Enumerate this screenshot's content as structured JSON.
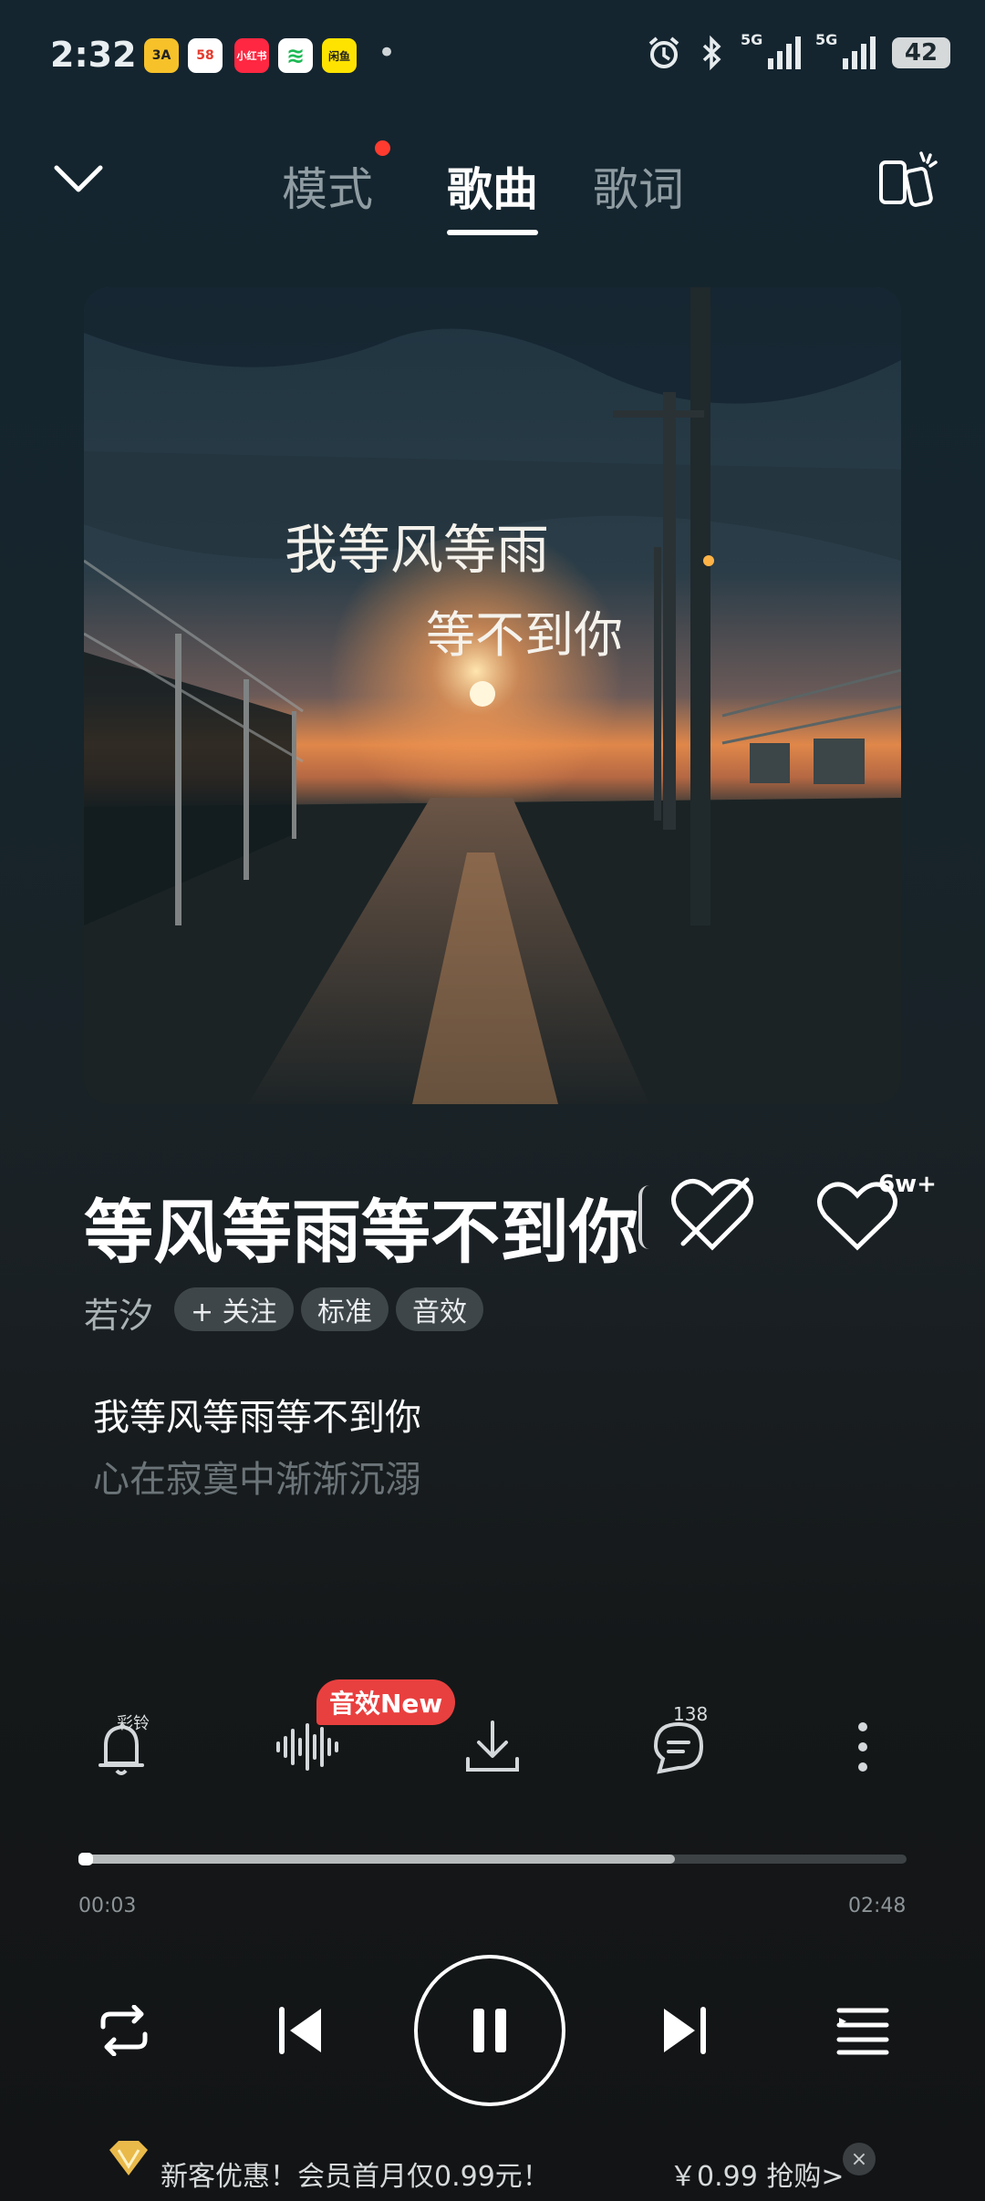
{
  "status_bar": {
    "time": "2:32",
    "apps": [
      "3A",
      "58",
      "小红书",
      "≋",
      "闲鱼"
    ],
    "more": "•",
    "network1": "5G",
    "network2": "5G",
    "battery": "42"
  },
  "nav": {
    "tabs": [
      {
        "label": "模式",
        "has_badge": true
      },
      {
        "label": "歌曲",
        "active": true
      },
      {
        "label": "歌词"
      }
    ]
  },
  "album": {
    "overlay_line1": "我等风等雨",
    "overlay_line2": "等不到你"
  },
  "song": {
    "title": "等风等雨等不到你",
    "artist": "若汐",
    "follow_label": "+ 关注",
    "quality_label": "标准",
    "effect_label": "音效",
    "like_count": "6w+"
  },
  "lyrics": {
    "current": "我等风等雨等不到你",
    "next": "心在寂寞中渐渐沉溺"
  },
  "actions": {
    "ringtone_label": "彩铃",
    "effect_badge": "音效New",
    "comment_count": "138"
  },
  "progress": {
    "current": "00:03",
    "total": "02:48",
    "fraction": 0.72
  },
  "promo": {
    "text": "新客优惠！会员首月仅0.99元！",
    "price": "￥0.99 抢购>",
    "close": "×"
  },
  "colors": {
    "accent_red": "#e8403f",
    "badge_red": "#ff3b30"
  }
}
